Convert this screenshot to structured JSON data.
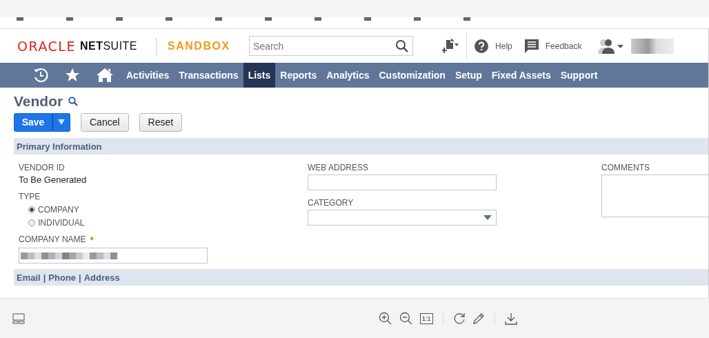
{
  "header": {
    "brand": "ORACLE",
    "product_bold": "NET",
    "product": "SUITE",
    "environment": "SANDBOX",
    "search": {
      "placeholder": "Search"
    },
    "help": "Help",
    "feedback": "Feedback"
  },
  "nav": [
    {
      "kind": "recent",
      "selected": false
    },
    {
      "kind": "favorites",
      "selected": false
    },
    {
      "kind": "home",
      "selected": false
    },
    {
      "kind": "text",
      "label": "Activities",
      "selected": false
    },
    {
      "kind": "text",
      "label": "Transactions",
      "selected": false
    },
    {
      "kind": "text",
      "label": "Lists",
      "selected": true
    },
    {
      "kind": "text",
      "label": "Reports",
      "selected": false
    },
    {
      "kind": "text",
      "label": "Analytics",
      "selected": false
    },
    {
      "kind": "text",
      "label": "Customization",
      "selected": false
    },
    {
      "kind": "text",
      "label": "Setup",
      "selected": false
    },
    {
      "kind": "text",
      "label": "Fixed Assets",
      "selected": false
    },
    {
      "kind": "text",
      "label": "Support",
      "selected": false
    }
  ],
  "page": {
    "title": "Vendor",
    "buttons": [
      {
        "label": "Save",
        "kind": "primary"
      },
      {
        "label": "Cancel",
        "kind": "secondary"
      },
      {
        "label": "Reset",
        "kind": "secondary"
      }
    ]
  },
  "primary_section": {
    "title": "Primary Information",
    "vendor_id": {
      "label": "VENDOR ID",
      "value": "To Be Generated"
    },
    "type": {
      "label": "TYPE",
      "options": [
        {
          "label": "COMPANY",
          "selected": true
        },
        {
          "label": "INDIVIDUAL",
          "selected": false
        }
      ]
    },
    "company_name": {
      "label": "COMPANY NAME",
      "required_mark": "*"
    },
    "web_address": {
      "label": "WEB ADDRESS"
    },
    "category": {
      "label": "CATEGORY"
    },
    "comments": {
      "label": "COMMENTS"
    }
  },
  "subtabs": {
    "items": [
      "Email",
      "Phone",
      "Address"
    ],
    "separator": "|"
  },
  "viewer": {
    "actual_size": "1:1"
  }
}
